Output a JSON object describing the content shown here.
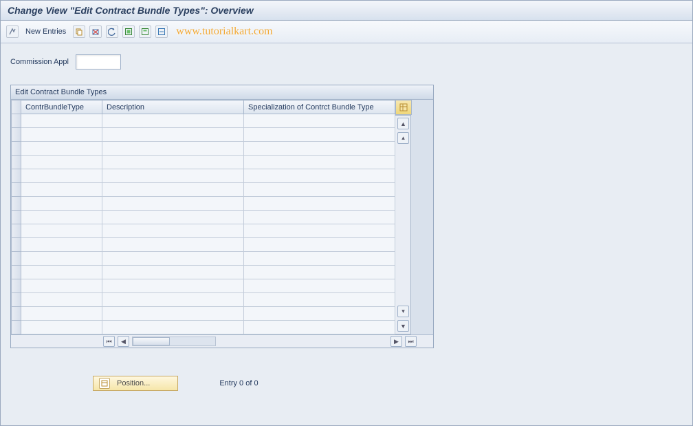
{
  "title": "Change View \"Edit Contract Bundle Types\": Overview",
  "toolbar": {
    "new_entries": "New Entries",
    "watermark": "www.tutorialkart.com"
  },
  "form": {
    "commission_appl_label": "Commission Appl",
    "commission_appl_value": ""
  },
  "panel": {
    "title": "Edit Contract Bundle Types",
    "columns": [
      "ContrBundleType",
      "Description",
      "Specialization of Contrct Bundle Type"
    ],
    "row_count": 16
  },
  "footer": {
    "position_label": "Position...",
    "entry_status": "Entry 0 of 0"
  }
}
